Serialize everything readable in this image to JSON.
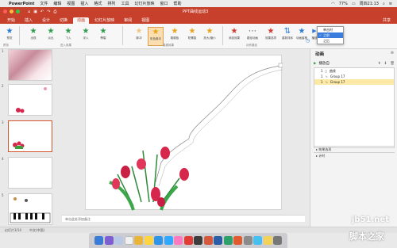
{
  "mac_menu": {
    "app": "PowerPoint",
    "items": [
      "文件",
      "编辑",
      "视图",
      "插入",
      "格式",
      "排列",
      "工具",
      "幻灯片放映",
      "窗口",
      "帮助"
    ],
    "battery": "77%",
    "clock": "周四21:13"
  },
  "window": {
    "title": "PPT曲线运动3"
  },
  "tabs": [
    "开始",
    "插入",
    "设计",
    "切换",
    "动画",
    "幻灯片放映",
    "审阅",
    "视图"
  ],
  "active_tab": "动画",
  "share_label": "共享",
  "ribbon": {
    "preview": "预览",
    "entrance": [
      "出现",
      "淡出",
      "飞入",
      "浮入",
      "劈裂"
    ],
    "emphasis": [
      "脉冲",
      "彩色脉冲",
      "跷跷板",
      "陀螺旋",
      "放大/缩小"
    ],
    "exit": [
      "添加效果",
      "路径动画",
      "效果选项"
    ],
    "order": [
      "重新排序",
      "动画窗格"
    ],
    "play": "播放",
    "groups": [
      "预览",
      "进入效果",
      "强调效果",
      "动作路径",
      "计时"
    ]
  },
  "dropdown": {
    "items": [
      "单击时",
      "之前",
      "之后"
    ],
    "selected": 1
  },
  "anim_pane": {
    "title": "动画",
    "play_label": "播放自",
    "items": [
      {
        "num": "1",
        "name": "曲线"
      },
      {
        "num": "1",
        "name": "Group 17"
      },
      {
        "num": "1",
        "name": "Group 17"
      }
    ],
    "selected_item": 2,
    "sections": [
      "效果选项",
      "计时"
    ]
  },
  "thumbs": [
    "1",
    "2",
    "3",
    "4",
    "5"
  ],
  "notes_placeholder": "单击此处添加备注",
  "status": {
    "slide": "幻灯片3/14",
    "lang": "中文(中国)"
  },
  "watermark": {
    "line1": "jb51.net",
    "line2": "脚本之家"
  },
  "colors": {
    "accent": "#c7402c",
    "anim_star": "#2e9e4a",
    "emph_star": "#e8a41a",
    "exit_star": "#d33a2f",
    "selection": "#d4532a",
    "dropdown_select": "#3b7ddd"
  }
}
